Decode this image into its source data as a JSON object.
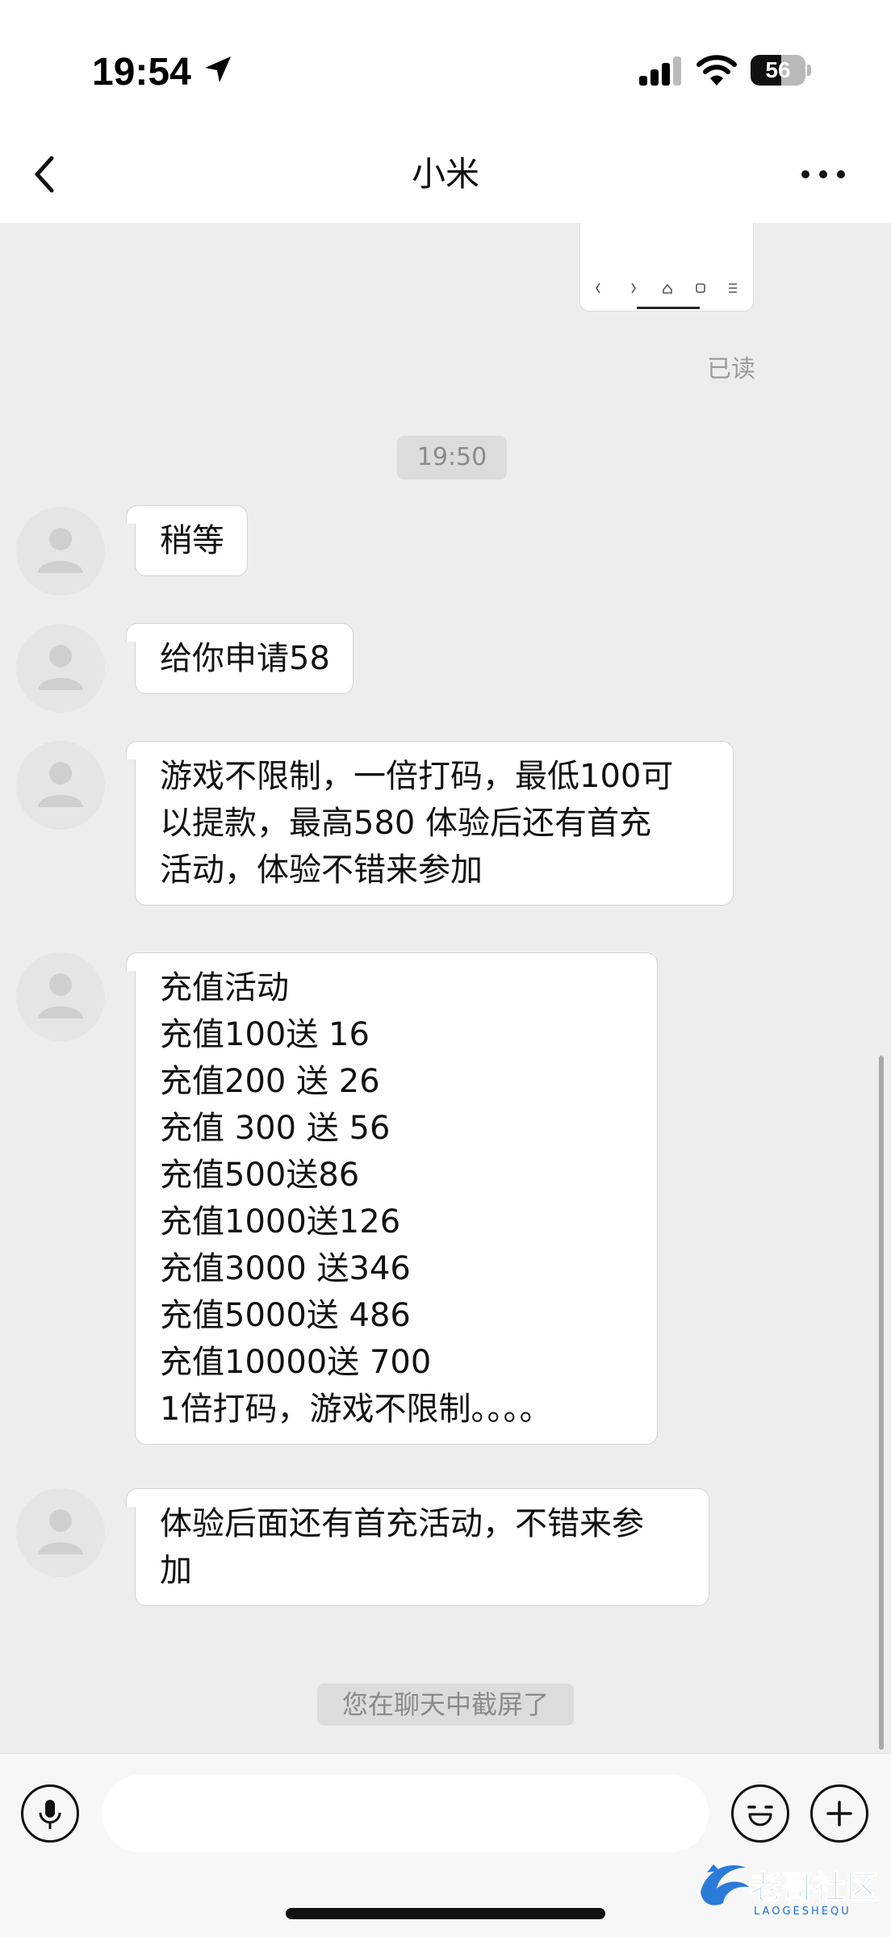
{
  "status_bar": {
    "time": "19:54",
    "battery_level": "56",
    "battery_fraction": 0.56,
    "location_icon": "location-arrow-icon",
    "signal_icon": "cellular-signal-icon",
    "wifi_icon": "wifi-icon"
  },
  "nav": {
    "title": "小米",
    "back_icon": "chevron-left-icon",
    "more_icon": "more-dots-icon"
  },
  "chat": {
    "read_status": "已读",
    "timestamp": "19:50",
    "messages": [
      {
        "text": "稍等"
      },
      {
        "text": "给你申请58"
      },
      {
        "text": "游戏不限制，一倍打码，最低100可\n以提款，最高580 体验后还有首充\n活动，体验不错来参加"
      },
      {
        "text": "充值活动\n充值100送 16\n充值200 送 26\n充值 300 送 56\n充值500送86\n充值1000送126\n充值3000 送346\n充值5000送 486\n充值10000送 700\n1倍打码，游戏不限制。。。。"
      },
      {
        "text": "体验后面还有首充活动，不错来参\n加"
      }
    ],
    "system_notice": "您在聊天中截屏了"
  },
  "input_bar": {
    "placeholder": "",
    "voice_icon": "microphone-icon",
    "emoji_icon": "smile-icon",
    "add_icon": "plus-icon"
  },
  "watermark": {
    "text": "老哥社区",
    "subtext": "LAOGESHEQU"
  },
  "colors": {
    "background": "#ededed",
    "bubble": "#ffffff",
    "bar": "#ffffff",
    "muted_text": "#9b9b9b"
  }
}
